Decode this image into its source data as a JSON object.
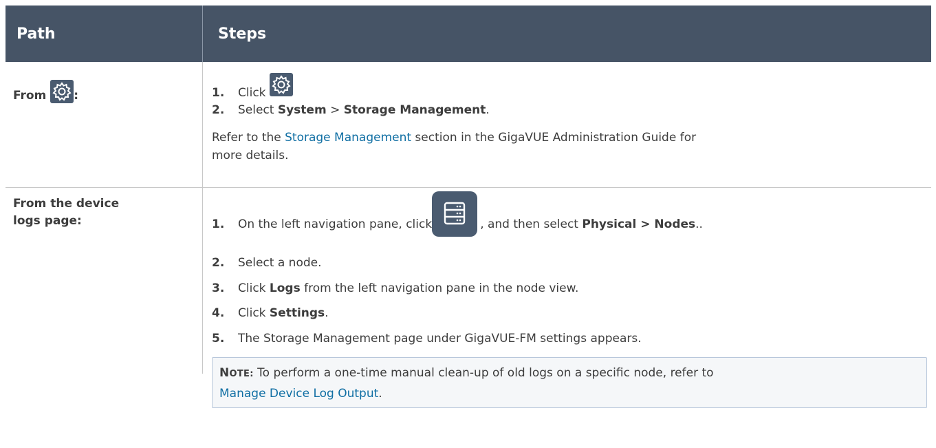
{
  "header": {
    "path_label": "Path",
    "steps_label": "Steps"
  },
  "row1": {
    "path_prefix": "From",
    "path_suffix": ":",
    "path_icon": "gear-icon",
    "steps": [
      {
        "num": "1.",
        "text": "Click"
      },
      {
        "num": "2.",
        "pre": "Select ",
        "bold1": "System",
        "mid": " > ",
        "bold2": "Storage Management",
        "post": "."
      }
    ],
    "refer_pre": "Refer to the ",
    "refer_link": "Storage Management",
    "refer_mid": " section in the GigaVUE Administration Guide for",
    "refer_line2": "more details."
  },
  "row2": {
    "path_line1": "From the device",
    "path_line2": "logs page:",
    "steps": [
      {
        "num": "1.",
        "pre": "On the left navigation pane, click",
        "mid": ", and then select ",
        "bold": "Physical > Nodes",
        "post": ".."
      },
      {
        "num": "2.",
        "text": "Select a node."
      },
      {
        "num": "3.",
        "pre": "Click ",
        "bold": "Logs",
        "post": " from the left navigation pane in the node view."
      },
      {
        "num": "4.",
        "pre": "Click ",
        "bold": "Settings",
        "post": "."
      },
      {
        "num": "5.",
        "text": "The Storage Management page under GigaVUE-FM settings appears."
      }
    ],
    "note": {
      "label_first": "N",
      "label_rest": "OTE:",
      "text": " To perform a one-time manual clean-up of old logs on a specific node, refer to",
      "link": "Manage Device Log Output",
      "post": "."
    }
  },
  "colors": {
    "header_bg": "#465466",
    "link": "#0f6ea3",
    "icon_bg": "#4a5b70"
  }
}
